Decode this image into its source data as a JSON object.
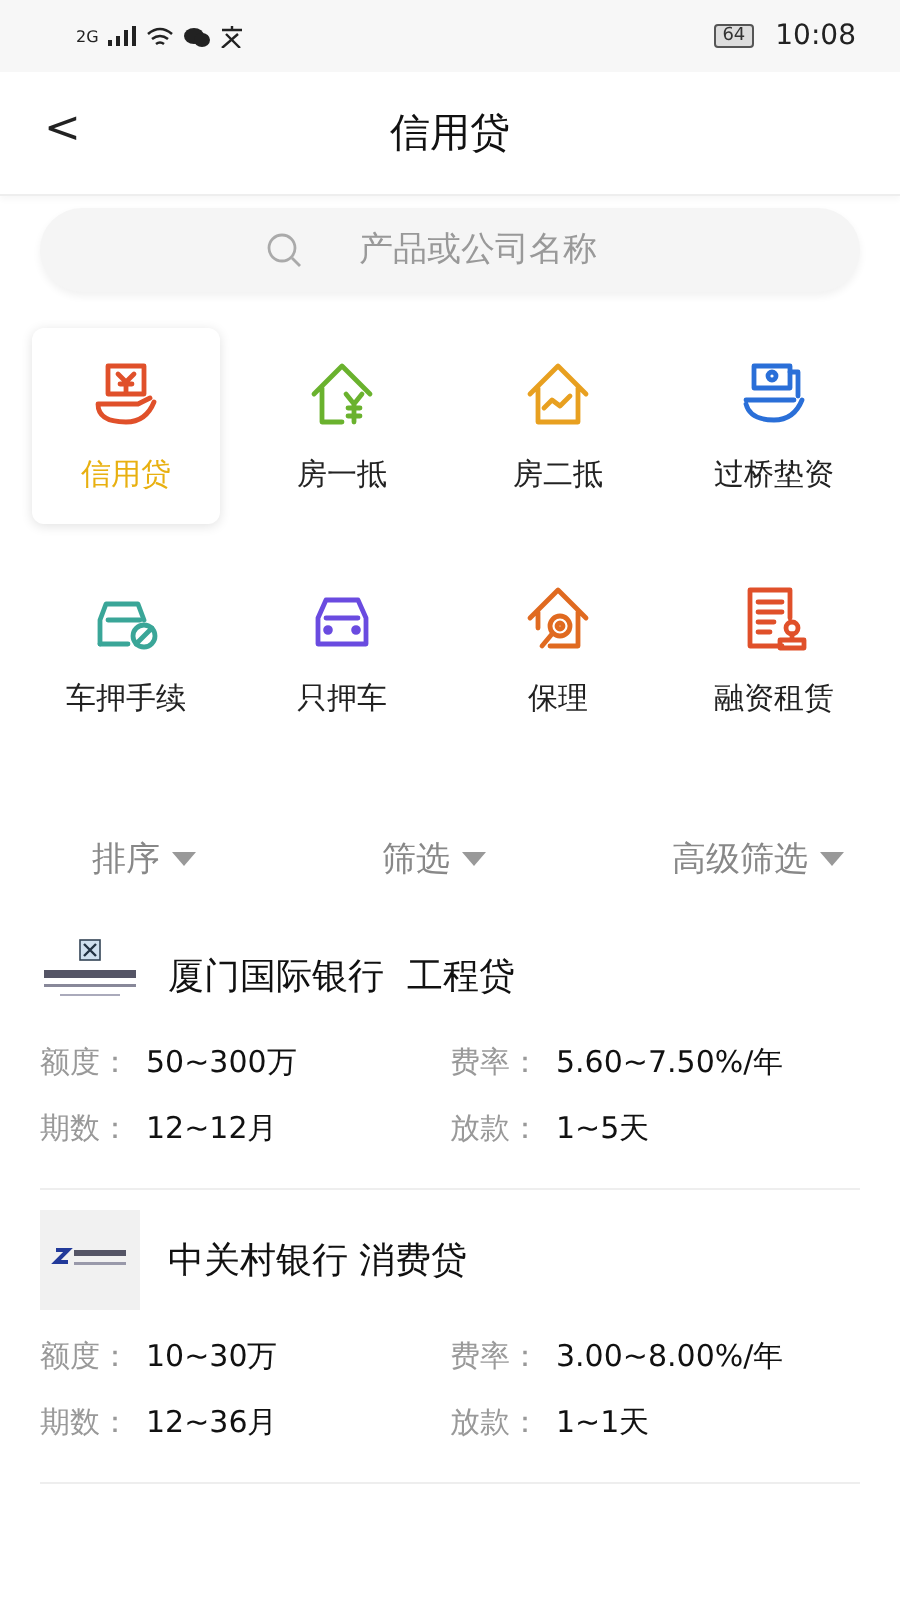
{
  "status_bar": {
    "network": "2G",
    "battery": "64",
    "time": "10:08"
  },
  "header": {
    "back": "<",
    "title": "信用贷"
  },
  "search": {
    "placeholder": "产品或公司名称"
  },
  "categories": [
    {
      "label": "信用贷",
      "kind": "cash-hand",
      "color": "#e0502a",
      "selected": true
    },
    {
      "label": "房一抵",
      "kind": "house-yen",
      "color": "#6ab22e",
      "selected": false
    },
    {
      "label": "房二抵",
      "kind": "house-chart",
      "color": "#e8a020",
      "selected": false
    },
    {
      "label": "过桥垫资",
      "kind": "bills-hand",
      "color": "#2a6fd8",
      "selected": false
    },
    {
      "label": "车押手续",
      "kind": "car-ban",
      "color": "#3aa698",
      "selected": false
    },
    {
      "label": "只押车",
      "kind": "car",
      "color": "#6a4be0",
      "selected": false
    },
    {
      "label": "保理",
      "kind": "house-key",
      "color": "#e06a20",
      "selected": false
    },
    {
      "label": "融资租赁",
      "kind": "document-stamp",
      "color": "#e0502a",
      "selected": false
    }
  ],
  "filters": [
    {
      "label": "排序"
    },
    {
      "label": "筛选"
    },
    {
      "label": "高级筛选"
    }
  ],
  "products": [
    {
      "name": "厦门国际银行  工程贷",
      "kind": "xiamen",
      "fields": [
        {
          "label": "额度：",
          "value": "50~300万"
        },
        {
          "label": "费率：",
          "value": "5.60~7.50%/年"
        },
        {
          "label": "期数：",
          "value": "12~12月"
        },
        {
          "label": "放款：",
          "value": "1~5天"
        }
      ]
    },
    {
      "name": "中关村银行 消费贷",
      "kind": "zhongguancun",
      "fields": [
        {
          "label": "额度：",
          "value": "10~30万"
        },
        {
          "label": "费率：",
          "value": "3.00~8.00%/年"
        },
        {
          "label": "期数：",
          "value": "12~36月"
        },
        {
          "label": "放款：",
          "value": "1~1天"
        }
      ]
    }
  ]
}
